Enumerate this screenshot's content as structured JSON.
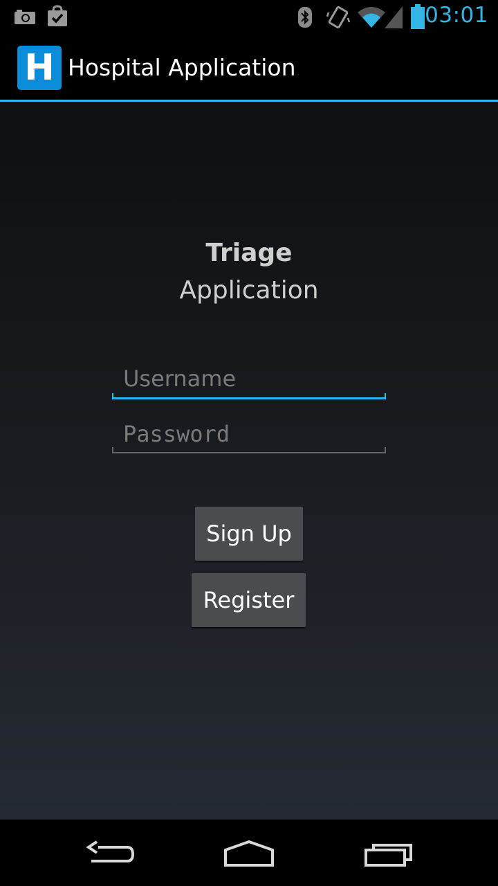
{
  "status_bar": {
    "time": "03:01",
    "icons": [
      "camera-icon",
      "shopping-bag-check-icon",
      "bluetooth-icon",
      "vibrate-icon",
      "wifi-icon",
      "cell-signal-icon",
      "battery-icon"
    ],
    "accent_color": "#33b5e5"
  },
  "action_bar": {
    "app_icon_letter": "H",
    "title": "Hospital Application",
    "icon_color": "#0a8cd8"
  },
  "login": {
    "title_line1": "Triage",
    "title_line2": "Application",
    "username_placeholder": "Username",
    "password_placeholder": "Password",
    "signup_label": "Sign Up",
    "register_label": "Register"
  },
  "nav_bar": {
    "icons": [
      "back-icon",
      "home-icon",
      "recent-apps-icon"
    ]
  }
}
